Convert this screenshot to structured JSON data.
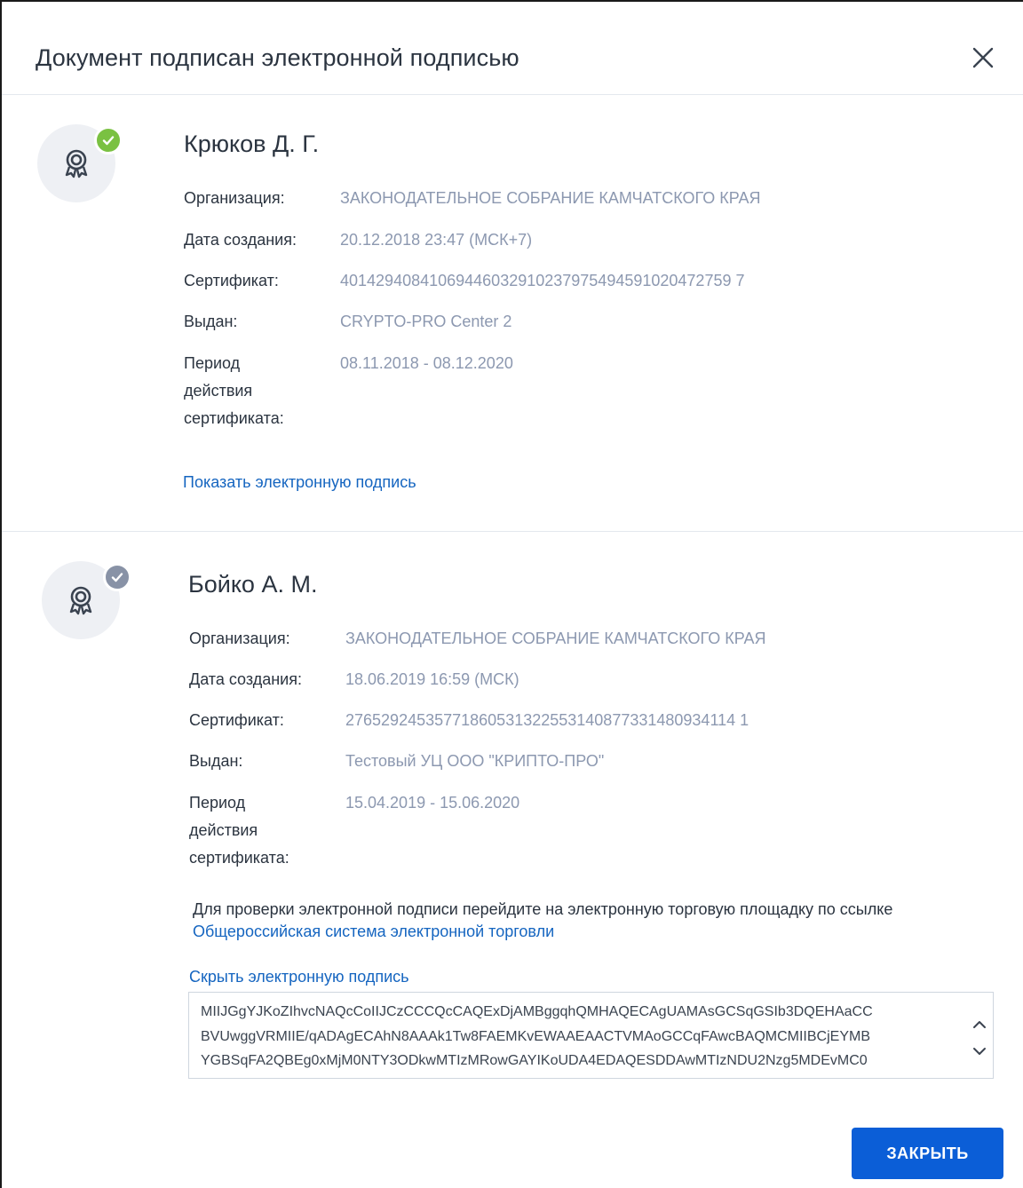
{
  "dialog": {
    "title": "Документ подписан электронной подписью",
    "close_button_label": "ЗАКРЫТЬ"
  },
  "colors": {
    "accent": "#0b5ed7",
    "link": "#1565c0",
    "value_text": "#8c98b0",
    "badge_valid": "#7ac142",
    "badge_neutral": "#8892a6"
  },
  "signers": [
    {
      "name": "Крюков Д. Г.",
      "status_icon": "check-green-icon",
      "fields": [
        {
          "label": "Организация:",
          "value": "ЗАКОНОДАТЕЛЬНОЕ СОБРАНИЕ КАМЧАТСКОГО КРАЯ"
        },
        {
          "label": "Дата создания:",
          "value": "20.12.2018 23:47 (МСК+7)"
        },
        {
          "label": "Сертификат:",
          "value": "40142940841069446032910237975494591020472759 7"
        },
        {
          "label": "Выдан:",
          "value": "CRYPTO-PRO Center 2"
        },
        {
          "label": "Период действия сертификата:",
          "value": "08.11.2018 - 08.12.2020"
        }
      ],
      "toggle_link": "Показать электронную подпись"
    },
    {
      "name": "Бойко А. М.",
      "status_icon": "check-gray-icon",
      "fields": [
        {
          "label": "Организация:",
          "value": "ЗАКОНОДАТЕЛЬНОЕ СОБРАНИЕ КАМЧАТСКОГО КРАЯ"
        },
        {
          "label": "Дата создания:",
          "value": "18.06.2019 16:59 (МСК)"
        },
        {
          "label": "Сертификат:",
          "value": "27652924535771860531322553140877331480934114 1"
        },
        {
          "label": "Выдан:",
          "value": "Тестовый УЦ ООО \"КРИПТО-ПРО\""
        },
        {
          "label": "Период действия сертификата:",
          "value": "15.04.2019 - 15.06.2020"
        }
      ],
      "notice_text": "Для проверки электронной подписи перейдите на электронную торговую площадку по ссылке ",
      "notice_link": "Общероссийская система электронной торговли",
      "toggle_link": "Скрыть электронную подпись",
      "signature_lines": [
        "MIIJGgYJKoZIhvcNAQcCoIIJCzCCCQcCAQExDjAMBggqhQMHAQECAgUAMAsGCSqGSIb3DQEHAaCC",
        "BVUwggVRMIIE/qADAgECAhN8AAAk1Tw8FAEMKvEWAAEAACTVMAoGCCqFAwcBAQMCMIIBCjEYMB",
        "YGBSqFA2QBEg0xMjM0NTY3ODkwMTIzMRowGAYIKoUDA4EDAQESDDAwMTIzNDU2Nzg5MDEvMC0"
      ]
    }
  ]
}
